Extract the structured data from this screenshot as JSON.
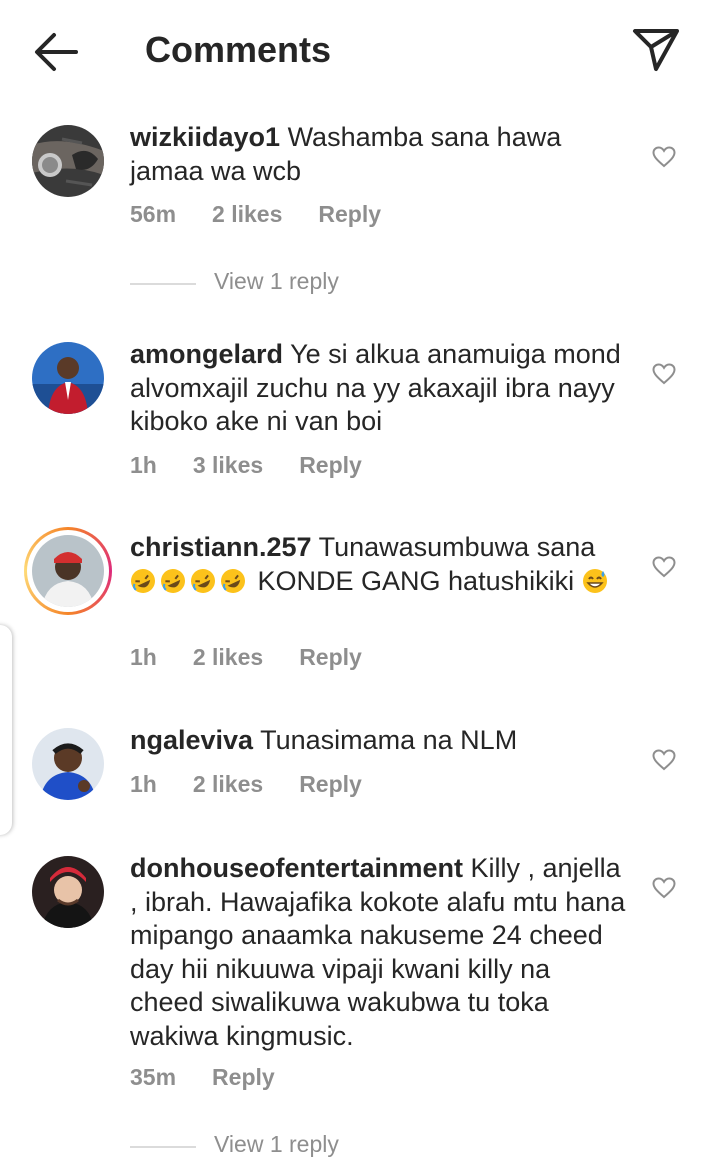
{
  "header": {
    "title": "Comments",
    "back_icon": "arrow-left-icon",
    "send_icon": "paper-plane-icon"
  },
  "comments": [
    {
      "username": "wizkiidayo1",
      "text": "Washamba sana hawa jamaa wa wcb",
      "time": "56m",
      "likes": "2 likes",
      "reply": "Reply",
      "view_replies": "View 1 reply"
    },
    {
      "username": "amongelard",
      "text": "Ye si alkua anamuiga mond alvomxajil zuchu na yy akaxajil ibra nayy kiboko ake ni van boi",
      "time": "1h",
      "likes": "3 likes",
      "reply": "Reply"
    },
    {
      "username": "christiann.257",
      "text": "Tunawasumbuwa sana",
      "text_after_emoji": "KONDE GANG hatushikiki",
      "emojis": [
        "rolling-on-floor-laughing",
        "rolling-on-floor-laughing",
        "rolling-on-floor-laughing",
        "rolling-on-floor-laughing",
        "grinning-sweat"
      ],
      "time": "1h",
      "likes": "2 likes",
      "reply": "Reply",
      "has_story": true
    },
    {
      "username": "ngaleviva",
      "text": "Tunasimama na NLM",
      "time": "1h",
      "likes": "2 likes",
      "reply": "Reply"
    },
    {
      "username": "donhouseofentertainment",
      "text": "Killy , anjella , ibrah. Hawajafika kokote alafu mtu hana mipango anaamka nakuseme 24 cheed day hii nikuuwa vipaji kwani killy na cheed siwalikuwa wakubwa tu toka wakiwa kingmusic.",
      "time": "35m",
      "reply": "Reply",
      "view_replies": "View 1 reply"
    }
  ],
  "colors": {
    "text": "#262626",
    "secondary": "#8e8e8e",
    "divider": "#dbdbdb"
  }
}
